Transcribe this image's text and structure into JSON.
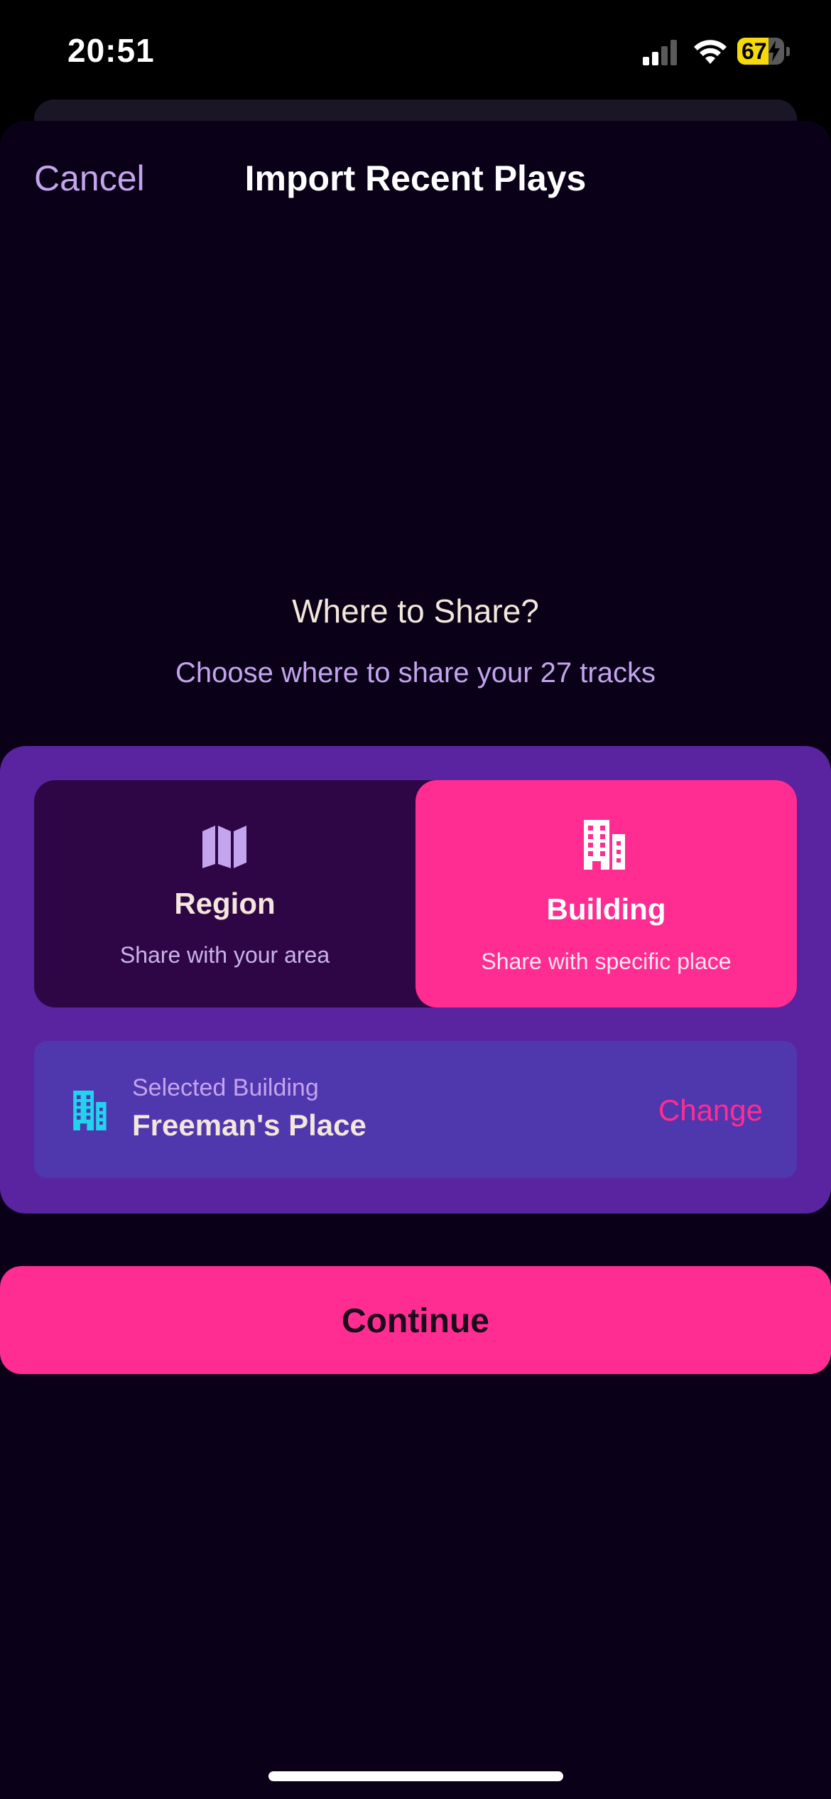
{
  "status_bar": {
    "time": "20:51",
    "battery_level": "67",
    "battery_charging": true,
    "battery_fill_fraction": 0.67,
    "signal_bars_active": 2,
    "signal_bars_total": 4
  },
  "header": {
    "cancel_label": "Cancel",
    "title": "Import Recent Plays"
  },
  "main": {
    "heading": "Where to Share?",
    "subheading": "Choose where to share your 27 tracks"
  },
  "share_options": [
    {
      "id": "region",
      "label": "Region",
      "description": "Share with your area",
      "icon": "map-icon",
      "selected": false
    },
    {
      "id": "building",
      "label": "Building",
      "description": "Share with specific place",
      "icon": "building-icon",
      "selected": true
    }
  ],
  "selected_building": {
    "caption": "Selected Building",
    "name": "Freeman's Place",
    "change_label": "Change",
    "icon": "building-icon"
  },
  "continue_label": "Continue",
  "colors": {
    "background": "#0a0118",
    "panel": "#5a23a0",
    "accent_pink": "#ff2d91",
    "unselected_option": "#2e0645",
    "selected_card": "#4f37ad",
    "lavender_text": "#c4a4ee",
    "cyan_icon": "#22d3ee",
    "battery_yellow": "#f5d90a"
  }
}
